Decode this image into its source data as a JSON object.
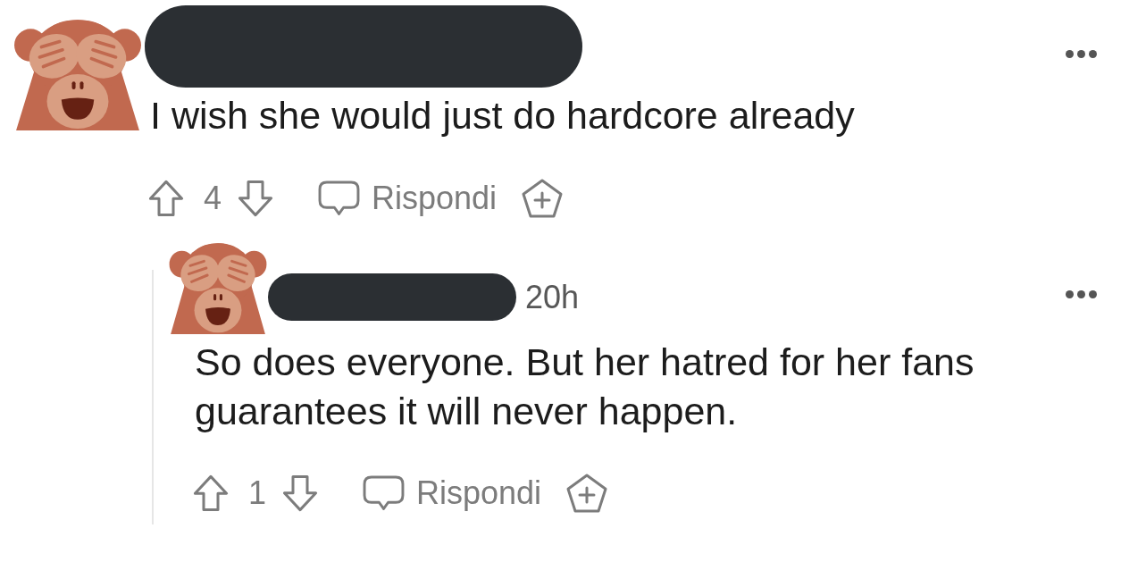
{
  "comments": [
    {
      "body": "I wish she would just do hardcore already",
      "score": "4",
      "reply_label": "Rispondi",
      "children": [
        {
          "time": "20h",
          "body": "So does everyone. But her hatred for her fans guarantees it will never happen.",
          "score": "1",
          "reply_label": "Rispondi"
        }
      ]
    }
  ]
}
